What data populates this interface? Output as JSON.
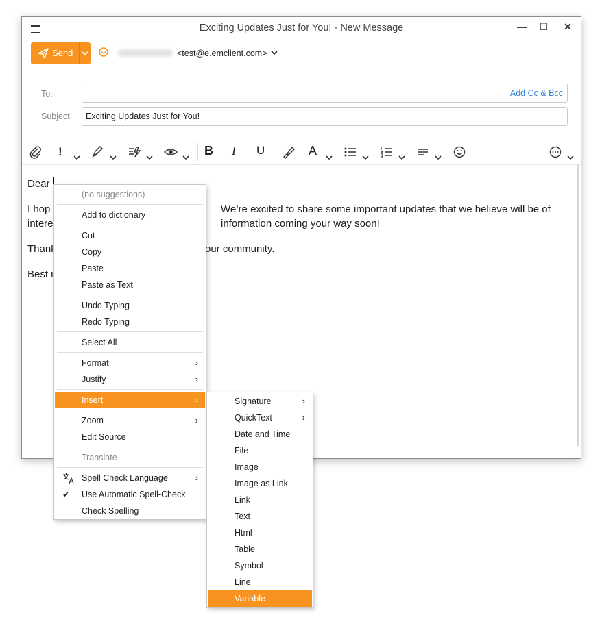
{
  "window": {
    "title": "Exciting Updates Just for You! - New Message",
    "minimize": "—",
    "maximize": "☐",
    "close": "✕"
  },
  "compose": {
    "send_label": "Send",
    "from_address": "<test@e.emclient.com>",
    "to_label": "To:",
    "to_value": "",
    "add_cc_bcc": "Add Cc & Bcc",
    "subject_label": "Subject:",
    "subject_value": "Exciting Updates Just for You!"
  },
  "toolbar": {
    "icons": [
      "attach-icon",
      "priority-icon",
      "sign-icon",
      "encrypt-icon",
      "read-receipt-icon",
      "bold-icon",
      "italic-icon",
      "underline-icon",
      "format-painter-icon",
      "font-color-icon",
      "bullet-list-icon",
      "numbered-list-icon",
      "align-icon",
      "emoji-icon",
      "more-icon"
    ],
    "bold": "B",
    "italic": "I",
    "underline": "U",
    "font_color": "A",
    "priority": "!"
  },
  "body": {
    "line1": "Dear",
    "line2_start": "I hop",
    "line2_end": "We’re excited to share some important updates that we believe will be of",
    "line3_start": "intere",
    "line3_end": "information coming your way soon!",
    "line4_start": "Thank",
    "line4_end": "our community.",
    "line5_start": "Best r"
  },
  "context_menu": {
    "items": [
      {
        "label": "(no suggestions)"
      },
      {
        "label": "Add to dictionary"
      },
      {
        "label": "Cut"
      },
      {
        "label": "Copy"
      },
      {
        "label": "Paste"
      },
      {
        "label": "Paste as Text"
      },
      {
        "label": "Undo Typing"
      },
      {
        "label": "Redo Typing"
      },
      {
        "label": "Select All"
      },
      {
        "label": "Format"
      },
      {
        "label": "Justify"
      },
      {
        "label": "Insert"
      },
      {
        "label": "Zoom"
      },
      {
        "label": "Edit Source"
      },
      {
        "label": "Translate"
      },
      {
        "label": "Spell Check Language"
      },
      {
        "label": "Use Automatic Spell-Check"
      },
      {
        "label": "Check Spelling"
      }
    ],
    "arrow": "›",
    "check": "✔"
  },
  "insert_submenu": {
    "items": [
      {
        "label": "Signature"
      },
      {
        "label": "QuickText"
      },
      {
        "label": "Date and Time"
      },
      {
        "label": "File"
      },
      {
        "label": "Image"
      },
      {
        "label": "Image as Link"
      },
      {
        "label": "Link"
      },
      {
        "label": "Text"
      },
      {
        "label": "Html"
      },
      {
        "label": "Table"
      },
      {
        "label": "Symbol"
      },
      {
        "label": "Line"
      },
      {
        "label": "Variable"
      }
    ]
  },
  "colors": {
    "accent": "#f7931e",
    "link": "#2a7fd4"
  }
}
